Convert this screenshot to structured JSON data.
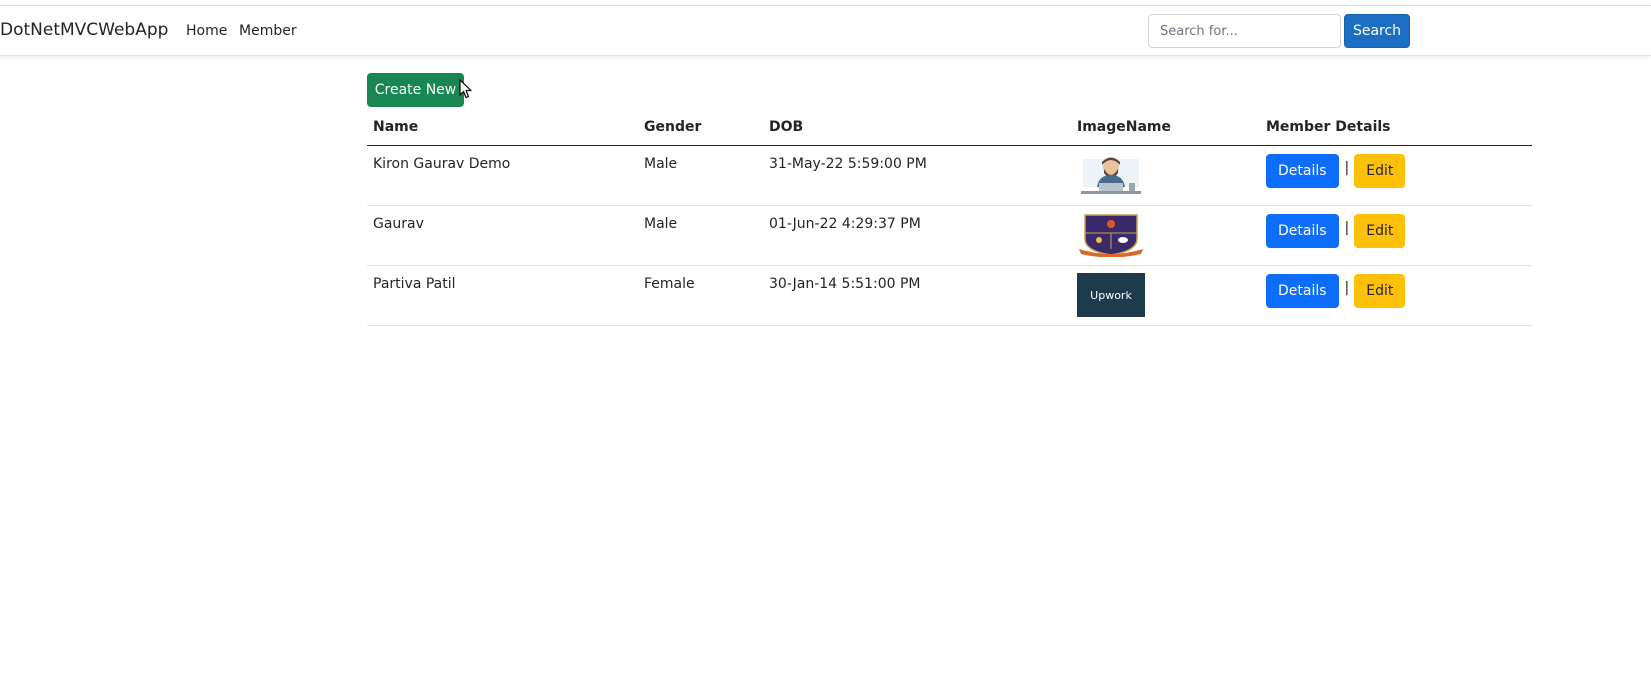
{
  "navbar": {
    "brand": "DotNetMVCWebApp",
    "links": [
      "Home",
      "Member"
    ],
    "search_placeholder": "Search for...",
    "search_label": "Search"
  },
  "main": {
    "create_label": "Create New",
    "table": {
      "headers": [
        "Name",
        "Gender",
        "DOB",
        "ImageName",
        "Member Details"
      ],
      "rows": [
        {
          "name": "Kiron Gaurav Demo",
          "gender": "Male",
          "dob": "31-May-22 5:59:00 PM",
          "image": "hacker-avatar-icon"
        },
        {
          "name": "Gaurav",
          "gender": "Male",
          "dob": "01-Jun-22 4:29:37 PM",
          "image": "university-crest-icon"
        },
        {
          "name": "Partiva Patil",
          "gender": "Female",
          "dob": "30-Jan-14 5:51:00 PM",
          "image": "upwork-logo-icon",
          "image_text": "Upwork"
        }
      ],
      "details_label": "Details",
      "separator": "|",
      "edit_label": "Edit"
    }
  },
  "colors": {
    "search_button": "#1b6ec2",
    "create_button": "#198754",
    "details_button": "#0d6efd",
    "edit_button": "#ffc107"
  }
}
